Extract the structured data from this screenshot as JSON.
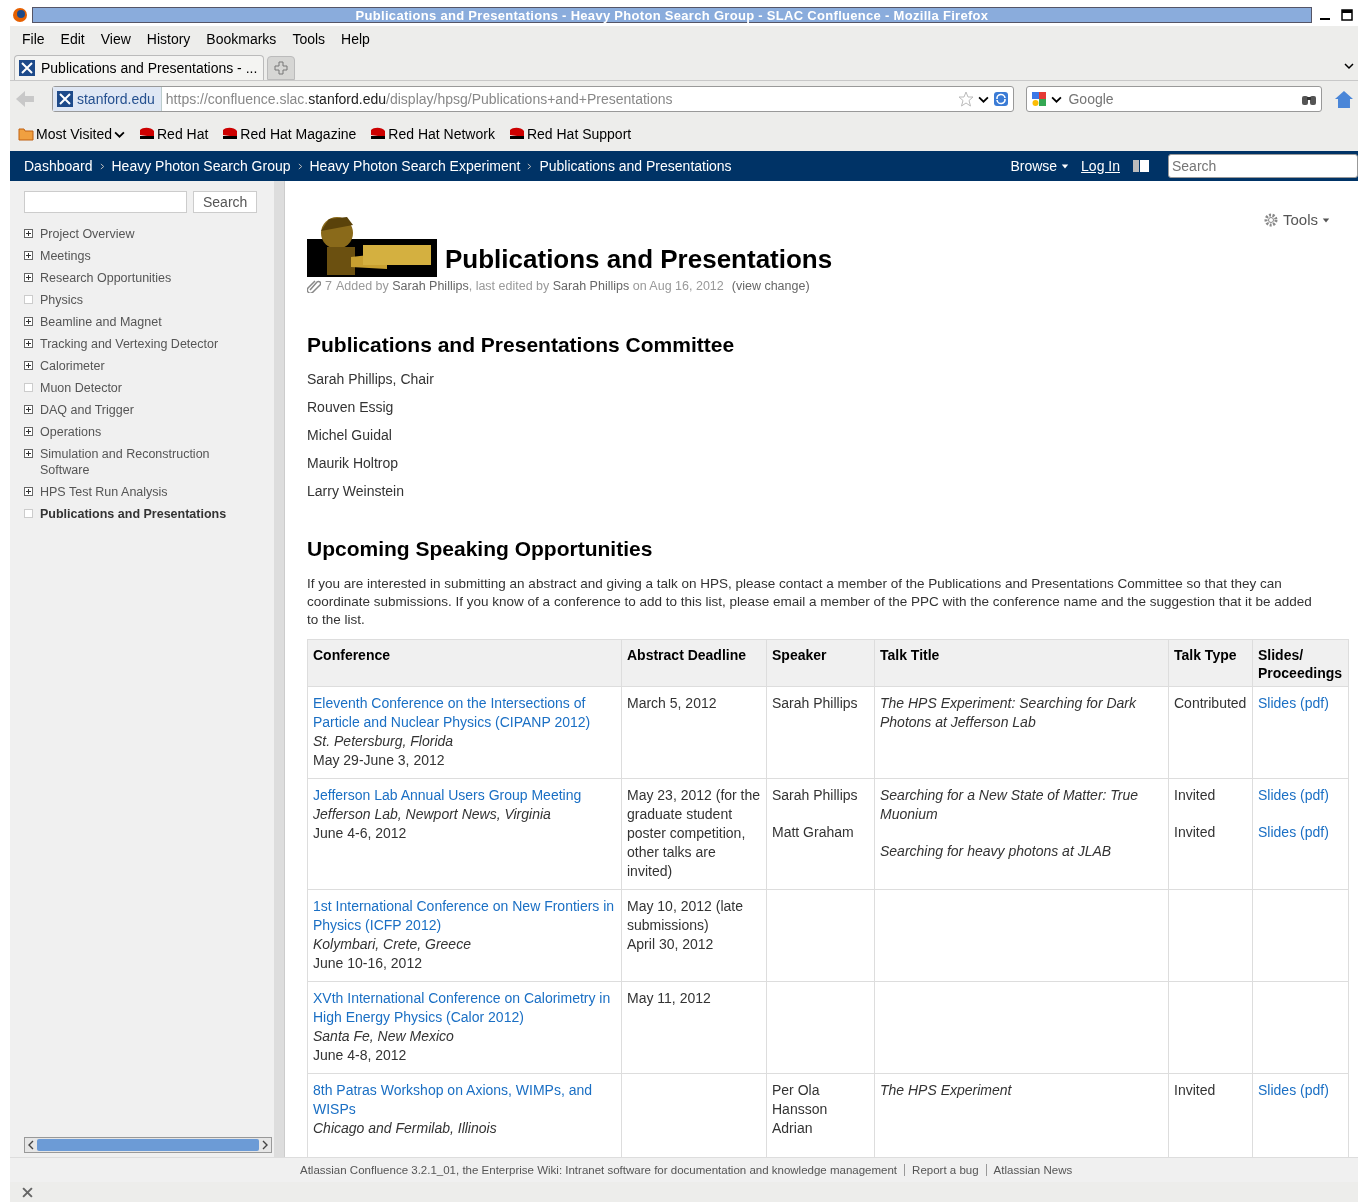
{
  "window": {
    "title": "Publications and Presentations - Heavy Photon Search Group - SLAC Confluence - Mozilla Firefox"
  },
  "menu": [
    "File",
    "Edit",
    "View",
    "History",
    "Bookmarks",
    "Tools",
    "Help"
  ],
  "tabs": [
    {
      "label": "Publications and Presentations - ...",
      "selected": true
    }
  ],
  "address": {
    "site": "stanford.edu",
    "url_pre": "https://confluence.slac.",
    "url_host": "stanford.edu",
    "url_post": "/display/hpsg/Publications+and+Presentations"
  },
  "web_search": {
    "placeholder": "Google"
  },
  "bookmarks": [
    {
      "label": "Most Visited",
      "kind": "folder"
    },
    {
      "label": "Red Hat",
      "kind": "site"
    },
    {
      "label": "Red Hat Magazine",
      "kind": "site"
    },
    {
      "label": "Red Hat Network",
      "kind": "site"
    },
    {
      "label": "Red Hat Support",
      "kind": "site"
    }
  ],
  "breadcrumbs": [
    "Dashboard",
    "Heavy Photon Search Group",
    "Heavy Photon Search Experiment",
    "Publications and Presentations"
  ],
  "header": {
    "browse": "Browse",
    "login": "Log In",
    "search_placeholder": "Search"
  },
  "sidebar": {
    "search_button": "Search",
    "items": [
      {
        "label": "Project Overview",
        "expandable": true,
        "selected": false
      },
      {
        "label": "Meetings",
        "expandable": true,
        "selected": false
      },
      {
        "label": "Research Opportunities",
        "expandable": true,
        "selected": false
      },
      {
        "label": "Physics",
        "expandable": false,
        "selected": false
      },
      {
        "label": "Beamline and Magnet",
        "expandable": true,
        "selected": false
      },
      {
        "label": "Tracking and Vertexing Detector",
        "expandable": true,
        "selected": false
      },
      {
        "label": "Calorimeter",
        "expandable": true,
        "selected": false
      },
      {
        "label": "Muon Detector",
        "expandable": false,
        "selected": false
      },
      {
        "label": "DAQ and Trigger",
        "expandable": true,
        "selected": false
      },
      {
        "label": "Operations",
        "expandable": true,
        "selected": false
      },
      {
        "label": "Simulation and Reconstruction Software",
        "expandable": true,
        "selected": false
      },
      {
        "label": "HPS Test Run Analysis",
        "expandable": true,
        "selected": false
      },
      {
        "label": "Publications and Presentations",
        "expandable": false,
        "selected": true
      }
    ]
  },
  "page": {
    "title": "Publications and Presentations",
    "tools": "Tools",
    "attachments": "7",
    "meta": "Added by **Sarah Phillips**, last edited by **Sarah Phillips** on Aug 16, 2012",
    "view_change": "(view change)",
    "committee_heading": "Publications and Presentations Committee",
    "committee": [
      "Sarah Phillips, Chair",
      "Rouven Essig",
      "Michel Guidal",
      "Maurik Holtrop",
      "Larry Weinstein"
    ],
    "upcoming_heading": "Upcoming Speaking Opportunities",
    "intro": "If you are interested in submitting an abstract and giving a talk on HPS, please contact a member of the Publications and Presentations Committee so that they can coordinate submissions.  If you know of a conference to add to this list, please email a member of the PPC with the conference name and the suggestion that it be added to the list."
  },
  "table": {
    "columns": [
      "Conference",
      "Abstract Deadline",
      "Speaker",
      "Talk Title",
      "Talk Type",
      "Slides/ Proceedings"
    ],
    "rows": [
      {
        "conference": "Eleventh Conference on the Intersections of Particle and Nuclear Physics (CIPANP 2012)",
        "location": "St. Petersburg, Florida",
        "dates": "May 29-June 3, 2012",
        "deadline": [
          "March 5, 2012"
        ],
        "speakers": [
          "Sarah Phillips"
        ],
        "talks": [
          {
            "title": "The HPS Experiment: Searching for Dark Photons at Jefferson Lab",
            "type": "Contributed",
            "slides": "Slides (pdf)"
          }
        ]
      },
      {
        "conference": "Jefferson Lab Annual Users Group Meeting",
        "location": "Jefferson Lab, Newport News, Virginia",
        "dates": "June 4-6, 2012",
        "deadline": [
          "May 23, 2012 (for the graduate student poster competition, other talks are invited)"
        ],
        "speakers": [
          "Sarah Phillips",
          "Matt Graham"
        ],
        "talks": [
          {
            "title": "Searching for a New State of Matter: True Muonium",
            "type": "Invited",
            "slides": "Slides (pdf)"
          },
          {
            "title": "Searching for heavy photons at JLAB",
            "type": "Invited",
            "slides": "Slides (pdf)"
          }
        ]
      },
      {
        "conference": "1st International Conference on New Frontiers in Physics (ICFP 2012)",
        "location": "Kolymbari, Crete, Greece",
        "dates": "June 10-16, 2012",
        "deadline": [
          "May 10, 2012 (late submissions)",
          "April 30, 2012"
        ],
        "speakers": [],
        "talks": []
      },
      {
        "conference": "XVth International Conference on Calorimetry in High Energy Physics (Calor 2012)",
        "location": "Santa Fe, New Mexico",
        "dates": "June 4-8, 2012",
        "deadline": [
          "May 11, 2012"
        ],
        "speakers": [],
        "talks": []
      },
      {
        "conference": "8th Patras Workshop on Axions, WIMPs, and WISPs",
        "location": "Chicago and Fermilab, Illinois",
        "deadline": [],
        "speakers": [
          "Per Ola Hansson Adrian"
        ],
        "talks": [
          {
            "title": "The HPS Experiment",
            "type": "Invited",
            "slides": "Slides (pdf)"
          }
        ]
      }
    ]
  },
  "footer": {
    "about": "Atlassian Confluence 3.2.1_01, the Enterprise Wiki: Intranet software for documentation and knowledge management",
    "links": [
      "Report a bug",
      "Atlassian News"
    ]
  }
}
